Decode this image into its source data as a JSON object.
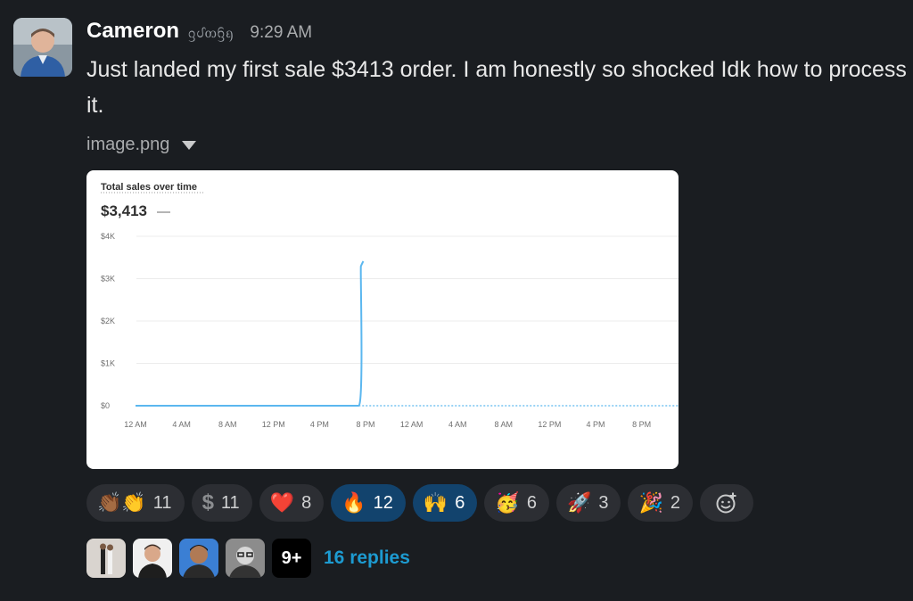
{
  "message": {
    "author": "Cameron",
    "status_glyphs": "ᦋᦔᦎᦌᦏ",
    "timestamp": "9:29 AM",
    "text": "Just landed my first sale $3413 order. I am honestly so shocked Idk how to process it.",
    "attachment_name": "image.png"
  },
  "chart_data": {
    "type": "line",
    "title": "Total sales over time",
    "total": "$3,413",
    "total_suffix": "—",
    "y_ticks": [
      "$0",
      "$1K",
      "$2K",
      "$3K",
      "$4K"
    ],
    "ylim": [
      0,
      4000
    ],
    "x_ticks": [
      "12 AM",
      "4 AM",
      "8 AM",
      "12 PM",
      "4 PM",
      "8 PM",
      "12 AM",
      "4 AM",
      "8 AM",
      "12 PM",
      "4 PM",
      "8 PM"
    ],
    "series": [
      {
        "values_points": [
          [
            0,
            0
          ],
          [
            4.85,
            0
          ],
          [
            4.9,
            3300
          ],
          [
            4.95,
            3413
          ]
        ]
      }
    ],
    "line_color": "#5bb7ef",
    "grid": true
  },
  "reactions": [
    {
      "emoji": "👏🏾👏",
      "count": "11",
      "icon": "clap-icon",
      "active": false
    },
    {
      "emoji": "$",
      "count": "11",
      "icon": "dollar-icon",
      "active": false
    },
    {
      "emoji": "❤️",
      "count": "8",
      "icon": "heart-icon",
      "active": false
    },
    {
      "emoji": "🔥",
      "count": "12",
      "icon": "fire-icon",
      "active": true
    },
    {
      "emoji": "🙌",
      "count": "6",
      "icon": "raised-hands-icon",
      "active": true
    },
    {
      "emoji": "🥳",
      "count": "6",
      "icon": "party-face-icon",
      "active": false
    },
    {
      "emoji": "🚀",
      "count": "3",
      "icon": "rocket-icon",
      "active": false
    },
    {
      "emoji": "🎉",
      "count": "2",
      "icon": "tada-icon",
      "active": false
    }
  ],
  "thread": {
    "more_count": "9+",
    "replies_label": "16 replies"
  },
  "colors": {
    "background": "#1a1d21",
    "active_pill": "#12436d",
    "link": "#1d9bd1"
  }
}
